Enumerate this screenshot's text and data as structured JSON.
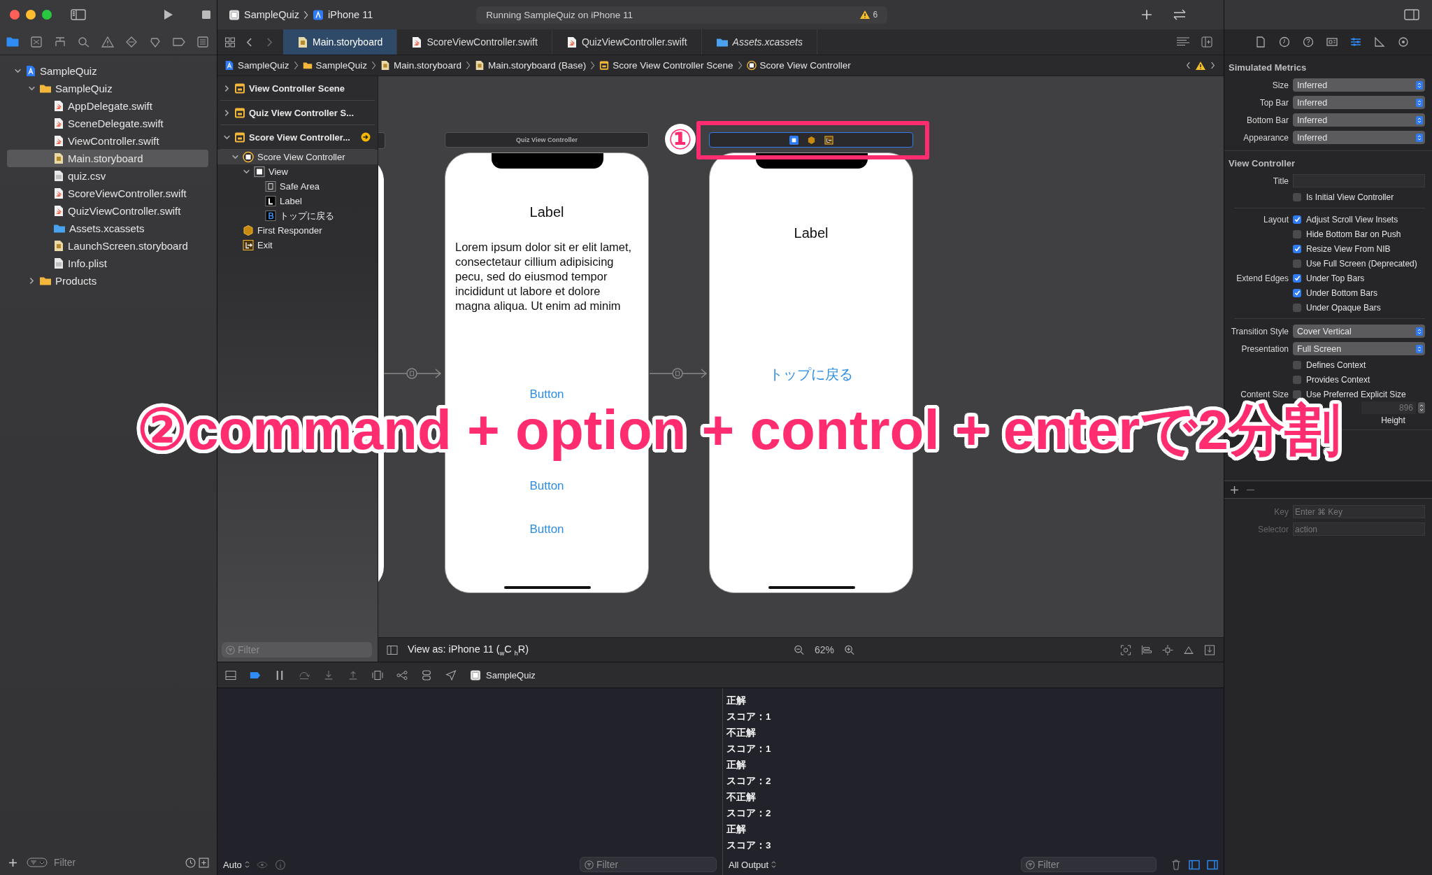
{
  "toolbar": {
    "scheme_app": "SampleQuiz",
    "scheme_device": "iPhone 11",
    "activity": "Running SampleQuiz on iPhone 11",
    "warning_count": "6"
  },
  "navigator": {
    "tabs": [
      {
        "kind": "folder",
        "selected": true
      },
      {
        "kind": "source",
        "selected": false
      },
      {
        "kind": "symbol",
        "selected": false
      },
      {
        "kind": "find",
        "selected": false
      },
      {
        "kind": "issue",
        "selected": false
      },
      {
        "kind": "test",
        "selected": false
      },
      {
        "kind": "debug",
        "selected": false
      },
      {
        "kind": "breakpoint",
        "selected": false
      },
      {
        "kind": "report",
        "selected": false
      }
    ],
    "tree": [
      {
        "label": "SampleQuiz",
        "kind": "project",
        "expanded": true,
        "selected": false,
        "children": [
          {
            "label": "SampleQuiz",
            "kind": "folder",
            "expanded": true,
            "selected": false,
            "children": [
              {
                "label": "AppDelegate.swift",
                "kind": "swift",
                "selected": false
              },
              {
                "label": "SceneDelegate.swift",
                "kind": "swift",
                "selected": false
              },
              {
                "label": "ViewController.swift",
                "kind": "swift",
                "selected": false
              },
              {
                "label": "Main.storyboard",
                "kind": "storyboard",
                "selected": true
              },
              {
                "label": "quiz.csv",
                "kind": "plain",
                "selected": false
              },
              {
                "label": "ScoreViewController.swift",
                "kind": "swift",
                "selected": false
              },
              {
                "label": "QuizViewController.swift",
                "kind": "swift",
                "selected": false
              },
              {
                "label": "Assets.xcassets",
                "kind": "assets",
                "selected": false
              },
              {
                "label": "LaunchScreen.storyboard",
                "kind": "storyboard",
                "selected": false
              },
              {
                "label": "Info.plist",
                "kind": "plain",
                "selected": false
              }
            ]
          },
          {
            "label": "Products",
            "kind": "folder",
            "expanded": false,
            "selected": false
          }
        ]
      }
    ],
    "filter_placeholder": "Filter"
  },
  "editor": {
    "tabs": [
      {
        "label": "Main.storyboard",
        "kind": "storyboard",
        "selected": true
      },
      {
        "label": "ScoreViewController.swift",
        "kind": "swift",
        "selected": false
      },
      {
        "label": "QuizViewController.swift",
        "kind": "swift",
        "selected": false
      },
      {
        "label": "Assets.xcassets",
        "kind": "assets",
        "selected": false
      }
    ],
    "breadcrumb": [
      {
        "label": "SampleQuiz",
        "kind": "project"
      },
      {
        "label": "SampleQuiz",
        "kind": "folder"
      },
      {
        "label": "Main.storyboard",
        "kind": "storyboard"
      },
      {
        "label": "Main.storyboard (Base)",
        "kind": "storyboard"
      },
      {
        "label": "Score View Controller Scene",
        "kind": "scene"
      },
      {
        "label": "Score View Controller",
        "kind": "controller"
      }
    ],
    "outline": {
      "items": [
        {
          "label": "View Controller Scene",
          "kind": "scene",
          "expanded": false,
          "selected": false
        },
        {
          "label": "Quiz View Controller S...",
          "kind": "scene",
          "expanded": false,
          "selected": false
        },
        {
          "label": "Score View Controller...",
          "kind": "scene",
          "expanded": true,
          "selected": false,
          "arrow": true,
          "children": [
            {
              "label": "Score View Controller",
              "kind": "controller",
              "expanded": true,
              "selected": true,
              "children": [
                {
                  "label": "View",
                  "kind": "view",
                  "expanded": true,
                  "selected": false,
                  "children": [
                    {
                      "label": "Safe Area",
                      "kind": "safearea",
                      "selected": false
                    },
                    {
                      "label": "Label",
                      "kind": "label",
                      "selected": false
                    },
                    {
                      "label": "トップに戻る",
                      "kind": "button",
                      "selected": false
                    }
                  ]
                }
              ]
            },
            {
              "label": "First Responder",
              "kind": "responder",
              "selected": false
            },
            {
              "label": "Exit",
              "kind": "exit",
              "selected": false
            }
          ]
        }
      ],
      "filter_placeholder": "Filter"
    },
    "canvas": {
      "scenes": [
        {
          "kind": "quiz",
          "title": "Quiz View Controller",
          "contents": [
            {
              "kind": "label",
              "text": "Label"
            },
            {
              "kind": "paragraph",
              "text": "Lorem ipsum dolor sit er elit lamet, consectetaur cillium adipisicing pecu, sed do eiusmod tempor incididunt ut labore et dolore magna aliqua. Ut enim ad minim"
            },
            {
              "kind": "button",
              "text": "Button"
            },
            {
              "kind": "button",
              "text": "Button"
            },
            {
              "kind": "button",
              "text": "Button"
            }
          ]
        },
        {
          "kind": "score",
          "contents": [
            {
              "kind": "label",
              "text": "Label"
            },
            {
              "kind": "button",
              "text": "トップに戻る"
            }
          ]
        }
      ],
      "annotation": {
        "badge": "①",
        "caption": "②command + option + control + enterで2分割"
      }
    },
    "footer": {
      "view_as": "View as: iPhone 11 ($_{w}$C $_{h}$R)",
      "zoom": "62%"
    }
  },
  "debug_bar": {
    "target": "SampleQuiz"
  },
  "variables": {
    "scope": "Auto",
    "filter_placeholder": "Filter"
  },
  "console": {
    "lines": [
      "正解",
      "スコア：1",
      "不正解",
      "スコア：1",
      "正解",
      "スコア：2",
      "不正解",
      "スコア：2",
      "正解",
      "スコア：3"
    ],
    "output": "All Output",
    "filter_placeholder": "Filter"
  },
  "inspector": {
    "tabs": [
      {
        "kind": "file",
        "selected": false
      },
      {
        "kind": "history",
        "selected": false
      },
      {
        "kind": "help",
        "selected": false
      },
      {
        "kind": "identity",
        "selected": false
      },
      {
        "kind": "attributes",
        "selected": true
      },
      {
        "kind": "size",
        "selected": false
      },
      {
        "kind": "connections",
        "selected": false
      }
    ],
    "simulated_metrics": {
      "title": "Simulated Metrics",
      "rows": [
        {
          "label": "Size",
          "value": "Inferred"
        },
        {
          "label": "Top Bar",
          "value": "Inferred"
        },
        {
          "label": "Bottom Bar",
          "value": "Inferred"
        },
        {
          "label": "Appearance",
          "value": "Inferred"
        }
      ]
    },
    "view_controller": {
      "title": "View Controller",
      "groups": [
        [
          {
            "kind": "field",
            "label": "Title"
          },
          {
            "kind": "checkbox",
            "text": "Is Initial View Controller",
            "checked": false
          }
        ],
        [
          {
            "kind": "checkbox",
            "label": "Layout",
            "text": "Adjust Scroll View Insets",
            "checked": true
          },
          {
            "kind": "checkbox",
            "text": "Hide Bottom Bar on Push",
            "checked": false
          },
          {
            "kind": "checkbox",
            "text": "Resize View From NIB",
            "checked": true
          },
          {
            "kind": "checkbox",
            "text": "Use Full Screen (Deprecated)",
            "checked": false
          },
          {
            "kind": "checkbox",
            "label": "Extend Edges",
            "text": "Under Top Bars",
            "checked": true
          },
          {
            "kind": "checkbox",
            "text": "Under Bottom Bars",
            "checked": true
          },
          {
            "kind": "checkbox",
            "text": "Under Opaque Bars",
            "checked": false
          }
        ],
        [
          {
            "kind": "popup",
            "label": "Transition Style",
            "value": "Cover Vertical"
          },
          {
            "kind": "popup",
            "label": "Presentation",
            "value": "Full Screen"
          },
          {
            "kind": "checkbox",
            "text": "Defines Context",
            "checked": false
          },
          {
            "kind": "checkbox",
            "text": "Provides Context",
            "checked": false
          },
          {
            "kind": "checkbox",
            "label": "Content Size",
            "text": "Use Preferred Explicit Size",
            "checked": false
          },
          {
            "kind": "size",
            "value": "896",
            "caption": "Height"
          }
        ]
      ]
    },
    "key_commands": [
      {
        "label": "Key",
        "placeholder": "Enter ⌘ Key"
      },
      {
        "label": "Selector",
        "placeholder": "action"
      }
    ]
  }
}
